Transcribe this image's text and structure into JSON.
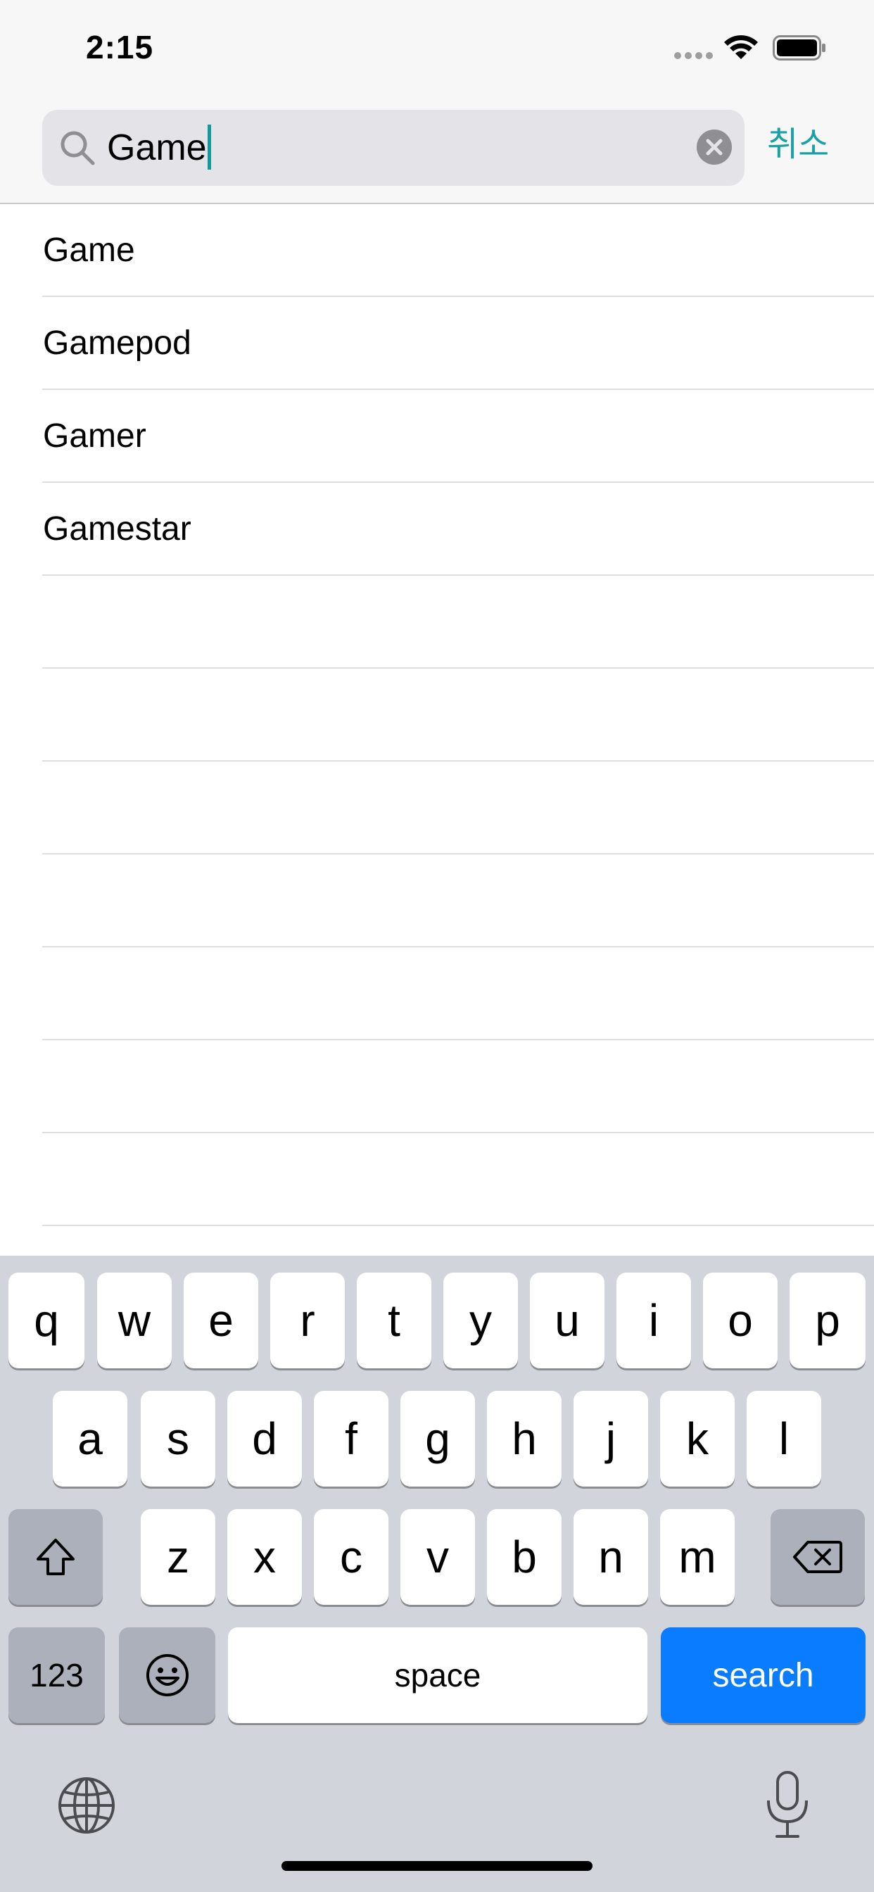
{
  "status_bar": {
    "time": "2:15"
  },
  "search": {
    "value": "Game",
    "cancel_label": "취소"
  },
  "suggestions": [
    "Game",
    "Gamepod",
    "Gamer",
    "Gamestar"
  ],
  "keyboard": {
    "row1": [
      "q",
      "w",
      "e",
      "r",
      "t",
      "y",
      "u",
      "i",
      "o",
      "p"
    ],
    "row2": [
      "a",
      "s",
      "d",
      "f",
      "g",
      "h",
      "j",
      "k",
      "l"
    ],
    "row3": [
      "z",
      "x",
      "c",
      "v",
      "b",
      "n",
      "m"
    ],
    "numbers_label": "123",
    "space_label": "space",
    "search_label": "search"
  },
  "colors": {
    "accent": "#1aa1a3",
    "search_key": "#0a7cff",
    "keyboard_bg": "#d1d4da"
  },
  "icons": [
    "search-icon",
    "clear-icon",
    "wifi-icon",
    "battery-icon",
    "shift-icon",
    "delete-icon",
    "emoji-icon",
    "globe-icon",
    "microphone-icon"
  ]
}
